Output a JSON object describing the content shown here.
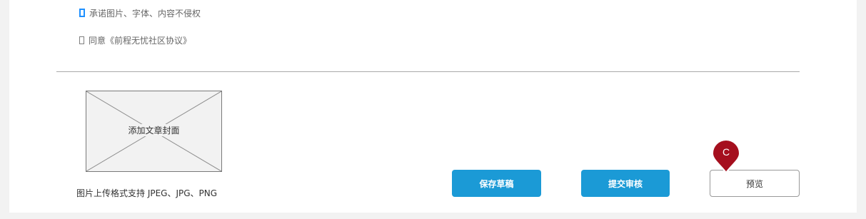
{
  "agreements": {
    "copyright": "承诺图片、字体、内容不侵权",
    "community": "同意《前程无忧社区协议》"
  },
  "cover": {
    "label": "添加文章封面",
    "hint": "图片上传格式支持 JPEG、JPG、PNG"
  },
  "actions": {
    "save_label": "保存草稿",
    "submit_label": "提交审核",
    "preview_label": "预览"
  },
  "annotation": {
    "marker_label": "C",
    "marker_color": "#a50f1e"
  },
  "colors": {
    "primary_button": "#1b9ad6",
    "focus_checkbox": "#1e90ff"
  }
}
